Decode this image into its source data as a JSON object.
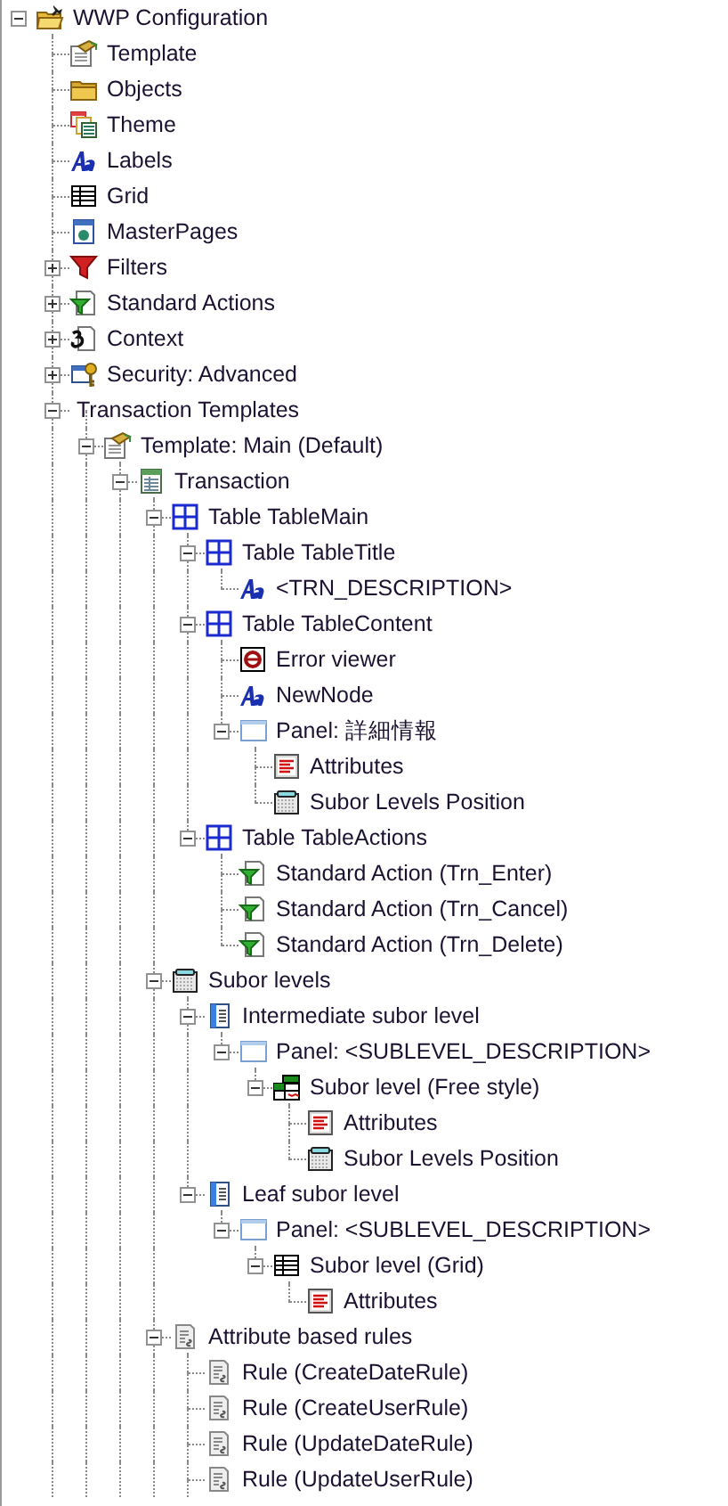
{
  "tree": [
    {
      "label": "WWP Configuration",
      "kind": "config",
      "expanded": true,
      "children": [
        {
          "label": "Template",
          "kind": "template"
        },
        {
          "label": "Objects",
          "kind": "folder"
        },
        {
          "label": "Theme",
          "kind": "theme"
        },
        {
          "label": "Labels",
          "kind": "labels"
        },
        {
          "label": "Grid",
          "kind": "grid"
        },
        {
          "label": "MasterPages",
          "kind": "masterpage"
        },
        {
          "label": "Filters",
          "kind": "filter",
          "expanded": false
        },
        {
          "label": "Standard Actions",
          "kind": "action",
          "expanded": false
        },
        {
          "label": "Context",
          "kind": "context",
          "expanded": false
        },
        {
          "label": "Security: Advanced",
          "kind": "security",
          "expanded": false
        },
        {
          "label": "Transaction Templates",
          "kind": "group",
          "expanded": true,
          "children": [
            {
              "label": "Template: Main (Default)",
              "kind": "template",
              "expanded": true,
              "children": [
                {
                  "label": "Transaction",
                  "kind": "transaction",
                  "expanded": true,
                  "children": [
                    {
                      "label": "Table TableMain",
                      "kind": "table",
                      "expanded": true,
                      "children": [
                        {
                          "label": "Table TableTitle",
                          "kind": "table",
                          "expanded": true,
                          "children": [
                            {
                              "label": "<TRN_DESCRIPTION>",
                              "kind": "labels"
                            }
                          ]
                        },
                        {
                          "label": "Table TableContent",
                          "kind": "table",
                          "expanded": true,
                          "children": [
                            {
                              "label": "Error viewer",
                              "kind": "error"
                            },
                            {
                              "label": "NewNode",
                              "kind": "labels"
                            },
                            {
                              "label": "Panel: 詳細情報",
                              "kind": "panel",
                              "expanded": true,
                              "children": [
                                {
                                  "label": "Attributes",
                                  "kind": "attributes"
                                },
                                {
                                  "label": "Subor Levels Position",
                                  "kind": "position"
                                }
                              ]
                            }
                          ]
                        },
                        {
                          "label": "Table TableActions",
                          "kind": "table",
                          "expanded": true,
                          "children": [
                            {
                              "label": "Standard Action (Trn_Enter)",
                              "kind": "action"
                            },
                            {
                              "label": "Standard Action (Trn_Cancel)",
                              "kind": "action"
                            },
                            {
                              "label": "Standard Action (Trn_Delete)",
                              "kind": "action"
                            }
                          ]
                        }
                      ]
                    },
                    {
                      "label": "Subor levels",
                      "kind": "position",
                      "expanded": true,
                      "children": [
                        {
                          "label": "Intermediate subor level",
                          "kind": "sublevel",
                          "expanded": true,
                          "children": [
                            {
                              "label": "Panel: <SUBLEVEL_DESCRIPTION>",
                              "kind": "panel",
                              "expanded": true,
                              "children": [
                                {
                                  "label": "Subor level (Free style)",
                                  "kind": "freestyle",
                                  "expanded": true,
                                  "children": [
                                    {
                                      "label": "Attributes",
                                      "kind": "attributes"
                                    },
                                    {
                                      "label": "Subor Levels Position",
                                      "kind": "position"
                                    }
                                  ]
                                }
                              ]
                            }
                          ]
                        },
                        {
                          "label": "Leaf subor level",
                          "kind": "sublevel",
                          "expanded": true,
                          "children": [
                            {
                              "label": "Panel: <SUBLEVEL_DESCRIPTION>",
                              "kind": "panel",
                              "expanded": true,
                              "children": [
                                {
                                  "label": "Subor level (Grid)",
                                  "kind": "grid",
                                  "expanded": true,
                                  "children": [
                                    {
                                      "label": "Attributes",
                                      "kind": "attributes"
                                    }
                                  ]
                                }
                              ]
                            }
                          ]
                        }
                      ]
                    },
                    {
                      "label": "Attribute based rules",
                      "kind": "rules",
                      "expanded": true,
                      "children": [
                        {
                          "label": "Rule (CreateDateRule)",
                          "kind": "rules"
                        },
                        {
                          "label": "Rule (CreateUserRule)",
                          "kind": "rules"
                        },
                        {
                          "label": "Rule (UpdateDateRule)",
                          "kind": "rules"
                        },
                        {
                          "label": "Rule (UpdateUserRule)",
                          "kind": "rules"
                        }
                      ]
                    }
                  ]
                }
              ]
            }
          ]
        }
      ]
    }
  ]
}
